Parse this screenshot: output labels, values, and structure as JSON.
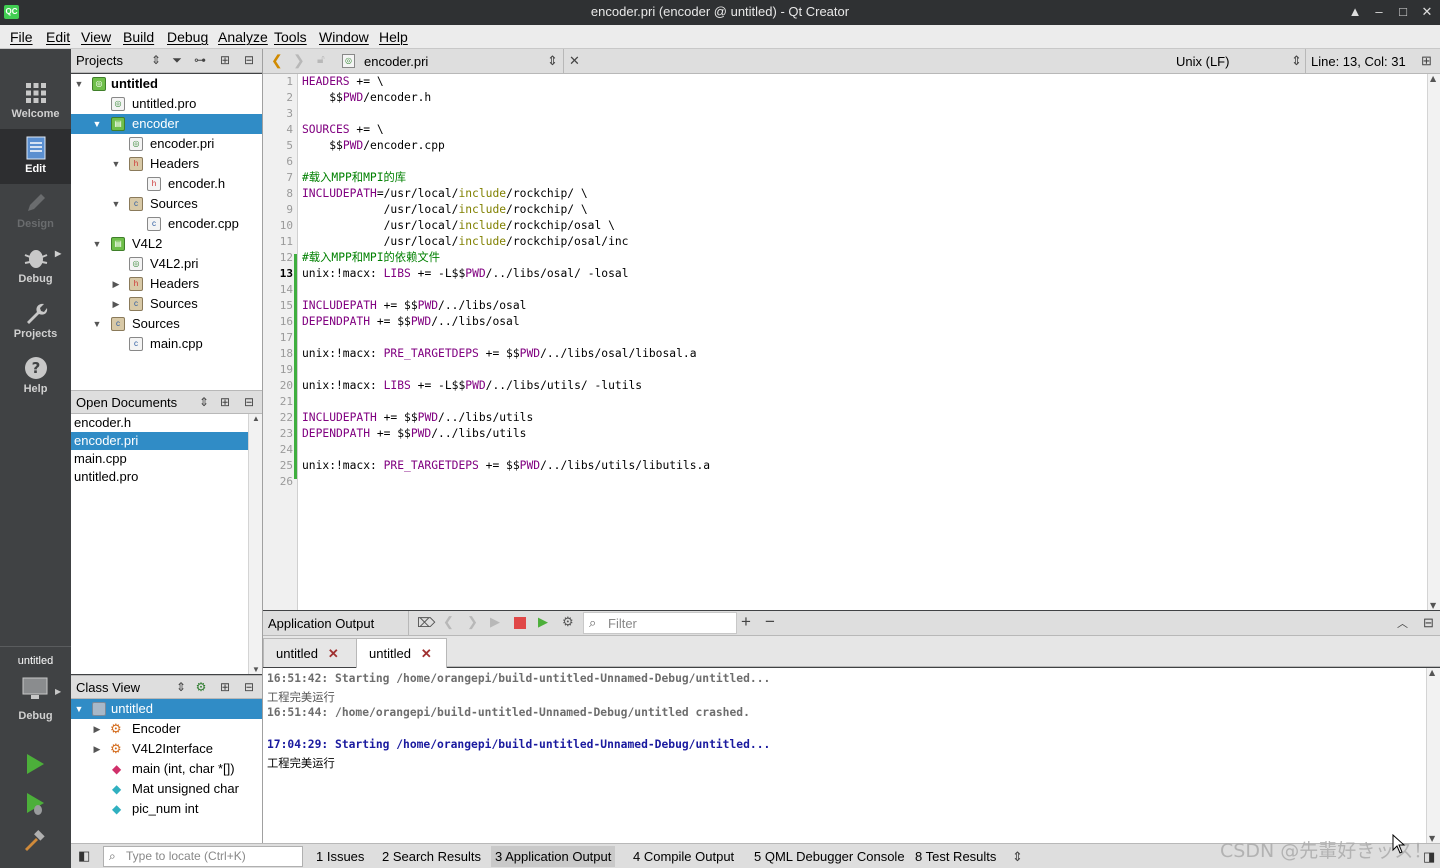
{
  "window": {
    "title": "encoder.pri (encoder @ untitled) - Qt Creator",
    "app_icon_text": "QC"
  },
  "menu": [
    "File",
    "Edit",
    "View",
    "Build",
    "Debug",
    "Analyze",
    "Tools",
    "Window",
    "Help"
  ],
  "modes": [
    {
      "label": "Welcome",
      "icon": "grid-icon"
    },
    {
      "label": "Edit",
      "icon": "edit-document-icon"
    },
    {
      "label": "Design",
      "icon": "pencil-icon"
    },
    {
      "label": "Debug",
      "icon": "bug-icon"
    },
    {
      "label": "Projects",
      "icon": "wrench-icon"
    },
    {
      "label": "Help",
      "icon": "help-icon"
    }
  ],
  "kit": {
    "project": "untitled",
    "config": "Debug"
  },
  "projects_pane": {
    "title": "Projects",
    "items": [
      {
        "label": "untitled",
        "bold": true
      },
      {
        "label": "untitled.pro"
      },
      {
        "label": "encoder"
      },
      {
        "label": "encoder.pri"
      },
      {
        "label": "Headers"
      },
      {
        "label": "encoder.h"
      },
      {
        "label": "Sources"
      },
      {
        "label": "encoder.cpp"
      },
      {
        "label": "V4L2"
      },
      {
        "label": "V4L2.pri"
      },
      {
        "label": "Headers"
      },
      {
        "label": "Sources"
      },
      {
        "label": "Sources"
      },
      {
        "label": "main.cpp"
      }
    ]
  },
  "open_documents": {
    "title": "Open Documents",
    "items": [
      "encoder.h",
      "encoder.pri",
      "main.cpp",
      "untitled.pro"
    ]
  },
  "class_view": {
    "title": "Class View",
    "items": [
      "untitled",
      "Encoder",
      "V4L2Interface",
      "main (int, char *[])",
      "Mat unsigned char",
      "pic_num int"
    ]
  },
  "editor": {
    "file": "encoder.pri",
    "line_ending": "Unix (LF)",
    "position": "Line: 13, Col: 31",
    "current_line": 13,
    "lines": [
      "HEADERS += \\",
      "    $$PWD/encoder.h",
      "",
      "SOURCES += \\",
      "    $$PWD/encoder.cpp",
      "",
      "#载入MPP和MPI的库",
      "INCLUDEPATH=/usr/local/include/rockchip/ \\",
      "            /usr/local/include/rockchip/ \\",
      "            /usr/local/include/rockchip/osal \\",
      "            /usr/local/include/rockchip/osal/inc",
      "#载入MPP和MPI的依赖文件",
      "unix:!macx: LIBS += -L$$PWD/../libs/osal/ -losal",
      "",
      "INCLUDEPATH += $$PWD/../libs/osal",
      "DEPENDPATH += $$PWD/../libs/osal",
      "",
      "unix:!macx: PRE_TARGETDEPS += $$PWD/../libs/osal/libosal.a",
      "",
      "unix:!macx: LIBS += -L$$PWD/../libs/utils/ -lutils",
      "",
      "INCLUDEPATH += $$PWD/../libs/utils",
      "DEPENDPATH += $$PWD/../libs/utils",
      "",
      "unix:!macx: PRE_TARGETDEPS += $$PWD/../libs/utils/libutils.a",
      ""
    ]
  },
  "output_pane": {
    "title": "Application Output",
    "filter_placeholder": "Filter",
    "tabs": [
      "untitled",
      "untitled"
    ],
    "lines": [
      {
        "text": "16:51:42: Starting /home/orangepi/build-untitled-Unnamed-Debug/untitled...",
        "style": "grey"
      },
      {
        "text": "工程完美运行",
        "style": "plain-grey"
      },
      {
        "text": "16:51:44: /home/orangepi/build-untitled-Unnamed-Debug/untitled crashed.",
        "style": "grey"
      },
      {
        "text": "17:04:29: Starting /home/orangepi/build-untitled-Unnamed-Debug/untitled...",
        "style": "blue"
      },
      {
        "text": "工程完美运行",
        "style": "plain"
      }
    ]
  },
  "statusbar": {
    "locate_placeholder": "Type to locate (Ctrl+K)",
    "tabs": [
      "1  Issues",
      "2  Search Results",
      "3  Application Output",
      "4  Compile Output",
      "5  QML Debugger Console",
      "8  Test Results"
    ]
  },
  "watermark": "CSDN @先輩好きッス！"
}
